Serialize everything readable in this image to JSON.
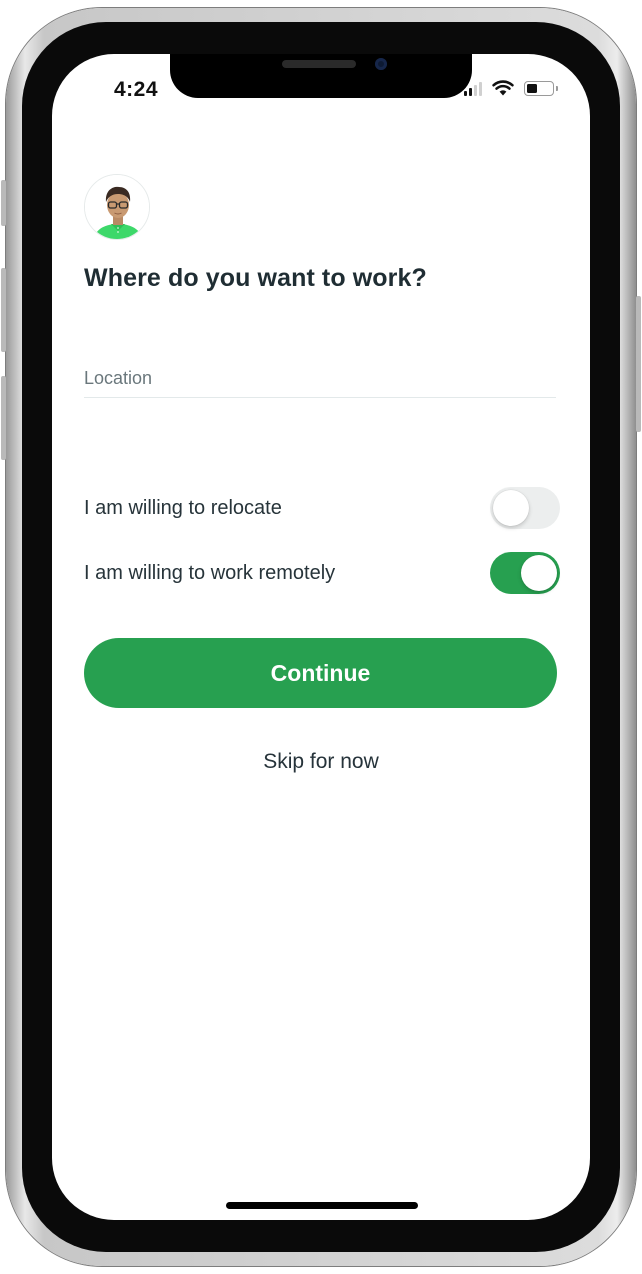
{
  "status_bar": {
    "time": "4:24",
    "icons": [
      "cellular-signal-icon",
      "wifi-icon",
      "battery-icon"
    ],
    "signal_bars_active": 2,
    "battery_level_percent": 40
  },
  "profile": {
    "avatar_icon": "user-avatar-illustration"
  },
  "page": {
    "title": "Where do you want to work?"
  },
  "form": {
    "location": {
      "placeholder": "Location",
      "value": ""
    },
    "toggles": [
      {
        "label": "I am willing to relocate",
        "checked": false
      },
      {
        "label": "I am willing to work remotely",
        "checked": true
      }
    ],
    "continue_label": "Continue",
    "skip_label": "Skip for now"
  },
  "colors": {
    "accent": "#27a050",
    "title_text": "#1f2d33",
    "body_text": "#27343a",
    "placeholder": "#6a777c",
    "toggle_off": "#eceeee"
  }
}
